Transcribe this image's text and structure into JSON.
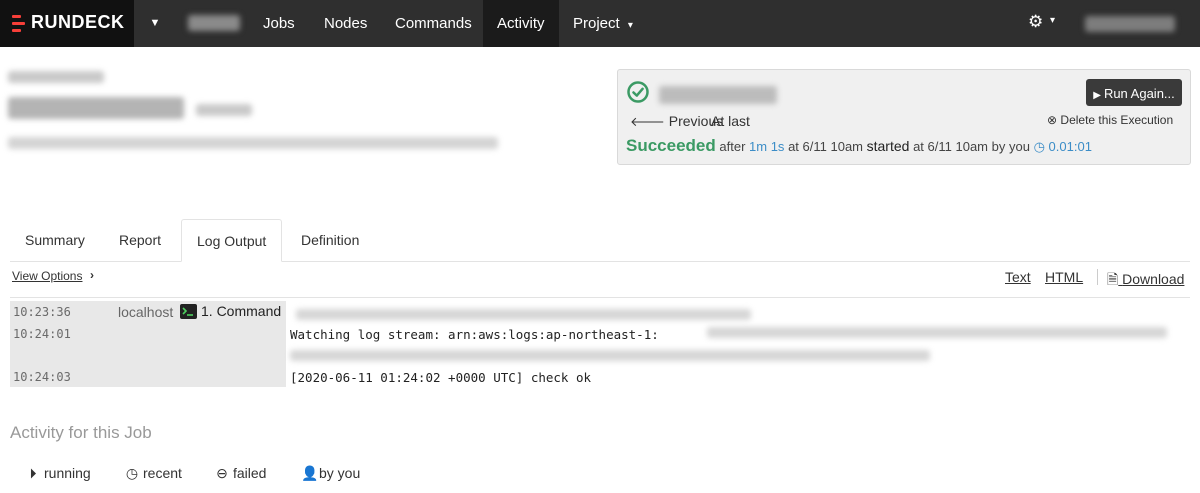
{
  "nav": {
    "brand": "RUNDECK",
    "items": [
      "Jobs",
      "Nodes",
      "Commands",
      "Activity",
      "Project"
    ],
    "active": "Activity",
    "project_caret": "▾",
    "settings_caret": "▾"
  },
  "execution": {
    "run_again": "Run Again...",
    "previous": "Previous",
    "at_last": "At last",
    "delete": "Delete this Execution",
    "status": "Succeeded",
    "after_label": "after",
    "after_duration": "1m 1s",
    "at_label": "at",
    "at_time": "6/11 10am",
    "started_label": "started",
    "started_at_label": "at",
    "started_time": "6/11 10am",
    "by_label": "by",
    "by_user": "you",
    "duration": "0.01:01",
    "status_color": "#3b9a64"
  },
  "tabs": [
    "Summary",
    "Report",
    "Log Output",
    "Definition"
  ],
  "active_tab": "Log Output",
  "log_controls": {
    "view_options": "View Options",
    "text": "Text",
    "html": "HTML",
    "download": "Download"
  },
  "log": {
    "rows": [
      {
        "time": "10:23:36",
        "node": "localhost",
        "step": "1. Command",
        "message": ""
      },
      {
        "time": "10:24:01",
        "node": "",
        "step": "",
        "message": "Watching log stream: arn:aws:logs:ap-northeast-1:"
      },
      {
        "time": "10:24:03",
        "node": "",
        "step": "",
        "message": "[2020-06-11 01:24:02 +0000 UTC] check ok"
      }
    ]
  },
  "activity": {
    "title": "Activity for this Job",
    "filters": [
      "running",
      "recent",
      "failed",
      "by you"
    ]
  }
}
